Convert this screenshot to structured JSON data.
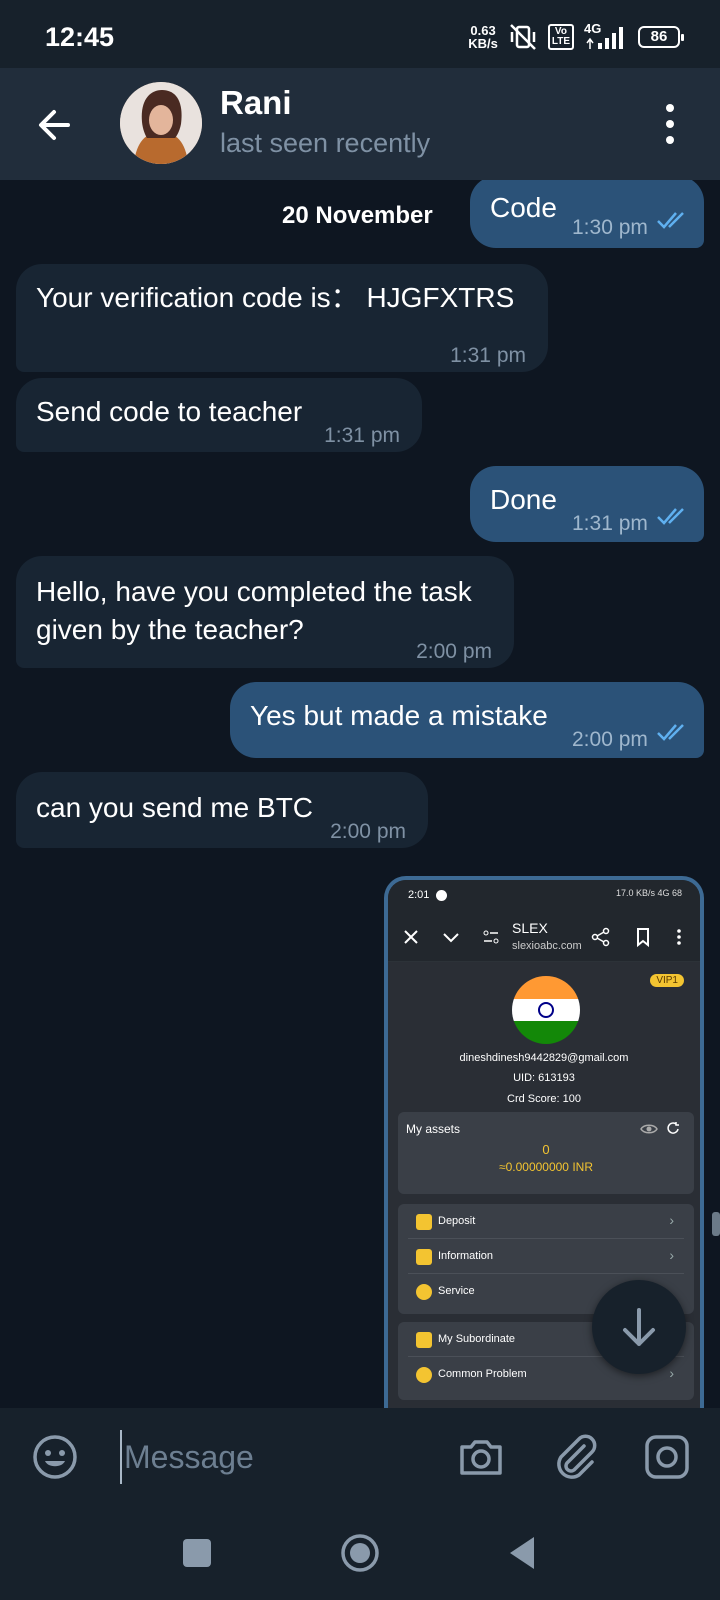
{
  "status_bar": {
    "time": "12:45",
    "net_speed_value": "0.63",
    "net_speed_unit": "KB/s",
    "volte_top": "Vo",
    "volte_bottom": "LTE",
    "network": "4G",
    "battery": "86"
  },
  "header": {
    "contact_name": "Rani",
    "contact_status": "last seen recently"
  },
  "chat": {
    "date_label": "20 November",
    "messages": [
      {
        "direction": "out",
        "text": "Code",
        "time": "1:30 pm"
      },
      {
        "direction": "in",
        "text": "Your verification code is： HJGFXTRS",
        "time": "1:31 pm"
      },
      {
        "direction": "in",
        "text": "Send code to teacher",
        "time": "1:31 pm"
      },
      {
        "direction": "out",
        "text": "Done",
        "time": "1:31 pm"
      },
      {
        "direction": "in",
        "text_line1": "Hello, have you completed the task",
        "text_line2": "given by the teacher?",
        "time": "2:00 pm"
      },
      {
        "direction": "out",
        "text": "Yes but made a mistake",
        "time": "2:00 pm"
      },
      {
        "direction": "in",
        "text": "can you send me BTC",
        "time": "2:00 pm"
      }
    ]
  },
  "shared_screenshot": {
    "time": "2:01",
    "status_right": "17.0 KB/s  4G  68",
    "site_title": "SLEX",
    "site_url": "slexioabc.com",
    "vip_badge": "VIP1",
    "email": "dineshdinesh9442829@gmail.com",
    "uid": "UID: 613193",
    "score": "Crd Score: 100",
    "assets_title": "My assets",
    "assets_value": "0",
    "assets_inr": "≈0.00000000 INR",
    "menu_group1": [
      "Deposit",
      "Information",
      "Service"
    ],
    "menu_group2": [
      "My Subordinate",
      "Common Problem"
    ],
    "flag_colors": [
      "#ff9933",
      "#ffffff",
      "#138808"
    ]
  },
  "input_bar": {
    "placeholder": "Message"
  },
  "colors": {
    "background": "#0e1621",
    "incoming_bubble": "#182533",
    "outgoing_bubble": "#2b5278",
    "header": "#212d3b",
    "tick_blue": "#5fb0f0"
  }
}
